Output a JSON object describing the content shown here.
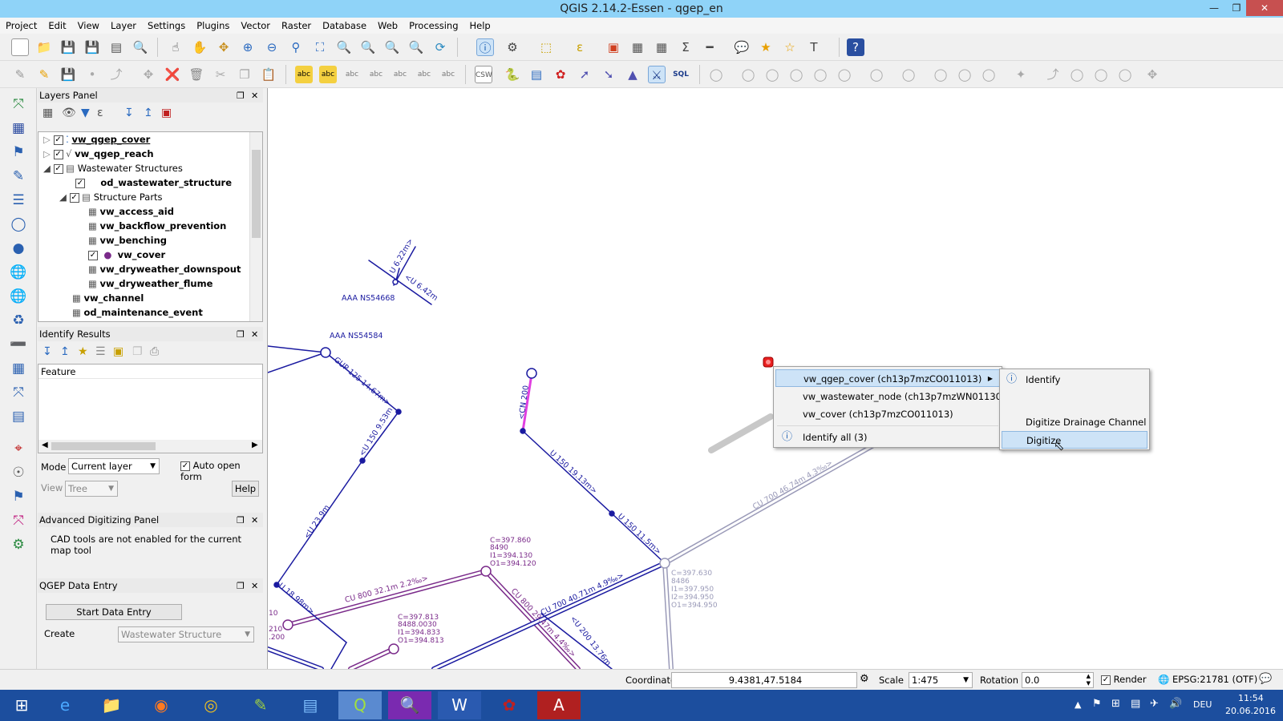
{
  "window": {
    "title": "QGIS 2.14.2-Essen - qgep_en"
  },
  "menubar": {
    "items": [
      "Project",
      "Edit",
      "View",
      "Layer",
      "Settings",
      "Plugins",
      "Vector",
      "Raster",
      "Database",
      "Web",
      "Processing",
      "Help"
    ]
  },
  "toolbar": {
    "csw_label": "CSW",
    "sql_label": "SQL"
  },
  "layers_panel": {
    "title": "Layers Panel",
    "layers": [
      {
        "label": "vw_qgep_cover",
        "checked": true,
        "bold": true,
        "underline": true
      },
      {
        "label": "vw_qgep_reach",
        "checked": true,
        "bold": true
      },
      {
        "label": "Wastewater Structures",
        "checked": true,
        "bold": false
      },
      {
        "label": "od_wastewater_structure",
        "checked": true,
        "bold": true
      },
      {
        "label": "Structure Parts",
        "checked": true,
        "bold": false
      },
      {
        "label": "vw_access_aid",
        "bold": true
      },
      {
        "label": "vw_backflow_prevention",
        "bold": true
      },
      {
        "label": "vw_benching",
        "bold": true
      },
      {
        "label": "vw_cover",
        "checked": true,
        "bold": true
      },
      {
        "label": "vw_dryweather_downspout",
        "bold": true
      },
      {
        "label": "vw_dryweather_flume",
        "bold": true
      },
      {
        "label": "vw_channel",
        "bold": true
      },
      {
        "label": "od_maintenance_event",
        "bold": true
      }
    ]
  },
  "identify_panel": {
    "title": "Identify Results",
    "column_header": "Feature",
    "mode_label": "Mode",
    "mode_value": "Current layer",
    "auto_open_label": "Auto open form",
    "view_label": "View",
    "view_value": "Tree",
    "help_label": "Help"
  },
  "advanced_digitizing": {
    "title": "Advanced Digitizing Panel",
    "message": "CAD tools are not enabled for the current map tool"
  },
  "qgep_panel": {
    "title": "QGEP Data Entry",
    "start_button": "Start Data Entry",
    "create_label": "Create",
    "create_value": "Wastewater Structure"
  },
  "context_menu": {
    "items": [
      "vw_qgep_cover (ch13p7mzCO011013)",
      "vw_wastewater_node (ch13p7mzWN011303)",
      "vw_cover (ch13p7mzCO011013)"
    ],
    "identify_all": "Identify all (3)",
    "submenu": [
      "Identify",
      "Digitize Drainage Channel",
      "Digitize"
    ]
  },
  "map_labels": {
    "ns1": "AAA NS54668",
    "ns2": "AAA NS54584",
    "u622": "U 6.22m>",
    "u642": "<U 6.42m",
    "gup": "GUP 125 14.67m>",
    "u150_953": "<U 150 9.53m",
    "u239": "<U 23.9m",
    "u1898": "U 18.98m>",
    "cn200": "<CN 200",
    "u150_1913": "U 150 19.13m>",
    "u150_115": "U 150 11.5m>",
    "cu700_4674": "CU 700 46.74m 4.3‰>",
    "cu800_321": "CU 800 32.1m 2.2‰>",
    "cu800_29": "CU 800 29.47m 4.4‰>",
    "cu700_4071": "CU 700 40.71m 4.9‰>",
    "u200": "<U 200 13.76m",
    "node1": [
      "C=397.860",
      "8490",
      "I1=394.130",
      "O1=394.120"
    ],
    "node2": [
      "C=397.813",
      "8488.0030",
      "I1=394.833",
      "O1=394.813"
    ],
    "node3": [
      "C=397.630",
      "8486",
      "I1=397.950",
      "I2=394.950",
      "O1=394.950"
    ],
    "left1": "10",
    "left2": "210",
    "left3": ".200"
  },
  "statusbar": {
    "coordinate_label": "Coordinate",
    "coordinate_value": "9.4381,47.5184",
    "scale_label": "Scale",
    "scale_value": "1:475",
    "rotation_label": "Rotation",
    "rotation_value": "0.0",
    "render_label": "Render",
    "crs_label": "EPSG:21781 (OTF)"
  },
  "taskbar": {
    "lang": "DEU",
    "time": "11:54",
    "date": "20.06.2016"
  },
  "colors": {
    "titlebar": "#8fd3f8",
    "taskbar": "#1c4e9e",
    "pipe_blue": "#1a1aa0",
    "pipe_purple": "#7a2a8a",
    "pipe_gray": "#9a9ab8",
    "highlight": "#e040e0"
  }
}
